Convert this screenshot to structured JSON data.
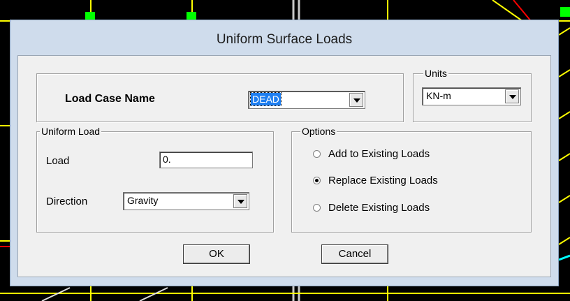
{
  "dialog": {
    "title": "Uniform Surface Loads",
    "load_case": {
      "label": "Load Case Name",
      "value": "DEAD"
    },
    "units": {
      "legend": "Units",
      "value": "KN-m"
    },
    "uniform_load": {
      "legend": "Uniform Load",
      "load_label": "Load",
      "load_value": "0.",
      "direction_label": "Direction",
      "direction_value": "Gravity"
    },
    "options": {
      "legend": "Options",
      "items": [
        {
          "label": "Add to Existing Loads",
          "selected": false
        },
        {
          "label": "Replace Existing Loads",
          "selected": true
        },
        {
          "label": "Delete Existing Loads",
          "selected": false
        }
      ]
    },
    "ok_label": "OK",
    "cancel_label": "Cancel"
  },
  "colors": {
    "canvas_bg": "#000000",
    "canvas_lines_yellow": "#ffff00",
    "canvas_lines_red": "#ff0000",
    "canvas_lines_green": "#00ff00",
    "dialog_frame": "#cfdcec",
    "selection_blue": "#1e7ef0"
  }
}
